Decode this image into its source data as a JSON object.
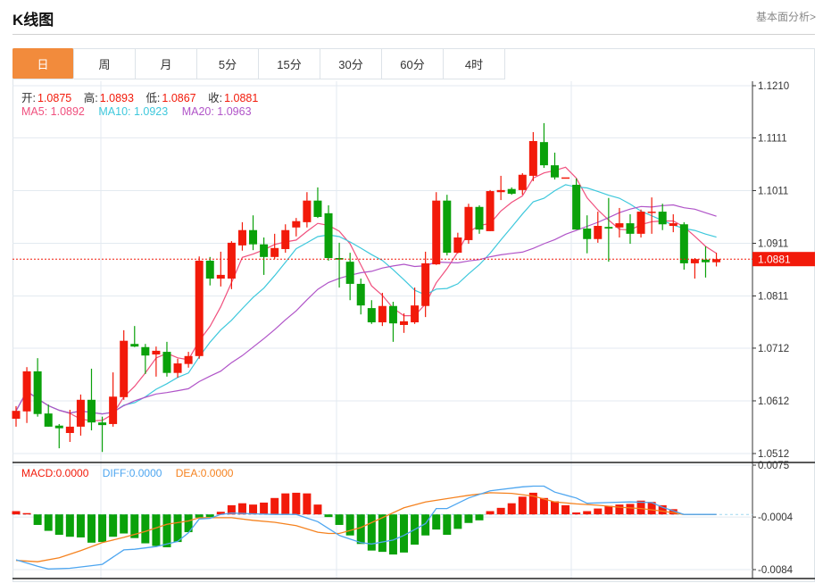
{
  "header": {
    "title": "K线图",
    "link": "基本面分析>"
  },
  "tabs": [
    {
      "label": "日",
      "active": true
    },
    {
      "label": "周"
    },
    {
      "label": "月"
    },
    {
      "label": "5分"
    },
    {
      "label": "15分"
    },
    {
      "label": "30分"
    },
    {
      "label": "60分"
    },
    {
      "label": "4时"
    }
  ],
  "ohlc_legend": {
    "open_label": "开:",
    "open": "1.0875",
    "high_label": "高:",
    "high": "1.0893",
    "low_label": "低:",
    "low": "1.0867",
    "close_label": "收:",
    "close": "1.0881"
  },
  "ma_legend": {
    "ma5": "MA5: 1.0892",
    "ma10": "MA10: 1.0923",
    "ma20": "MA20: 1.0963"
  },
  "macd_legend": {
    "macd": "MACD:0.0000",
    "diff": "DIFF:0.0000",
    "dea": "DEA:0.0000"
  },
  "colors": {
    "up": "#f21a0a",
    "down": "#0aa10a",
    "ma5": "#f0507e",
    "ma10": "#3ec8dc",
    "ma20": "#b054c8",
    "diff": "#4ea6f0",
    "dea": "#f5821f",
    "accent": "#f28b3c"
  },
  "chart_data": [
    {
      "type": "candlestick",
      "price_axis": {
        "ticks": [
          "1.1210",
          "1.1111",
          "1.1011",
          "1.0911",
          "1.0811",
          "1.0712",
          "1.0612",
          "1.0512"
        ],
        "range": [
          1.0512,
          1.121
        ]
      },
      "current_price": "1.0881",
      "ohlc": [
        [
          1.0578,
          1.0602,
          1.0563,
          1.0593
        ],
        [
          1.0592,
          1.0676,
          1.057,
          1.0668
        ],
        [
          1.0668,
          1.0693,
          1.0582,
          1.0587
        ],
        [
          1.0588,
          1.0605,
          1.0563,
          1.0563
        ],
        [
          1.0565,
          1.0568,
          1.0522,
          1.056
        ],
        [
          1.0551,
          1.0595,
          1.0534,
          1.0563
        ],
        [
          1.0563,
          1.0624,
          1.0546,
          1.0614
        ],
        [
          1.0614,
          1.0673,
          1.0556,
          1.0571
        ],
        [
          1.0571,
          1.0582,
          1.0515,
          1.0566
        ],
        [
          1.0568,
          1.0666,
          1.0563,
          1.062
        ],
        [
          1.0619,
          1.0746,
          1.0614,
          1.0726
        ],
        [
          1.072,
          1.0754,
          1.0714,
          1.0715
        ],
        [
          1.0714,
          1.072,
          1.0663,
          1.0698
        ],
        [
          1.07,
          1.0715,
          1.0658,
          1.0707
        ],
        [
          1.0705,
          1.0724,
          1.0658,
          1.0665
        ],
        [
          1.0665,
          1.0692,
          1.0656,
          1.0683
        ],
        [
          1.0682,
          1.0705,
          1.0675,
          1.0697
        ],
        [
          1.0697,
          1.0886,
          1.0692,
          1.0878
        ],
        [
          1.0878,
          1.0885,
          1.0831,
          1.0844
        ],
        [
          1.0844,
          1.0895,
          1.0829,
          1.0851
        ],
        [
          1.0844,
          1.0915,
          1.0824,
          1.0912
        ],
        [
          1.0907,
          1.0951,
          1.0897,
          1.0936
        ],
        [
          1.0936,
          1.0964,
          1.0898,
          1.0909
        ],
        [
          1.0909,
          1.0922,
          1.0851,
          1.0885
        ],
        [
          1.0885,
          1.0929,
          1.0881,
          1.0902
        ],
        [
          1.09,
          1.0947,
          1.0893,
          1.0936
        ],
        [
          1.0941,
          1.0959,
          1.0924,
          1.0953
        ],
        [
          1.0951,
          1.1008,
          1.0941,
          1.0992
        ],
        [
          1.0992,
          1.1017,
          1.0959,
          1.0961
        ],
        [
          1.0968,
          1.0983,
          1.0878,
          1.0883
        ],
        [
          1.0883,
          1.0912,
          1.0827,
          1.088
        ],
        [
          1.0876,
          1.0893,
          1.0803,
          1.0834
        ],
        [
          1.0834,
          1.0844,
          1.0776,
          1.0793
        ],
        [
          1.0788,
          1.0803,
          1.0758,
          1.0761
        ],
        [
          1.0761,
          1.0817,
          1.0754,
          1.0792
        ],
        [
          1.0792,
          1.08,
          1.0724,
          1.0759
        ],
        [
          1.0756,
          1.0778,
          1.0741,
          1.0763
        ],
        [
          1.0761,
          1.0827,
          1.0758,
          1.0793
        ],
        [
          1.0792,
          1.0895,
          1.0771,
          1.0873
        ],
        [
          1.0871,
          1.1008,
          1.087,
          1.0992
        ],
        [
          1.0992,
          1.1003,
          1.0888,
          1.0893
        ],
        [
          1.0893,
          1.0931,
          1.0892,
          1.0922
        ],
        [
          1.0917,
          1.0986,
          1.091,
          1.098
        ],
        [
          1.098,
          1.0983,
          1.0929,
          1.0937
        ],
        [
          1.0934,
          1.1012,
          1.0934,
          1.101
        ],
        [
          1.1008,
          1.1039,
          1.0993,
          1.1012
        ],
        [
          1.1014,
          1.1017,
          1.1003,
          1.1005
        ],
        [
          1.1012,
          1.1044,
          1.1003,
          1.1041
        ],
        [
          1.1039,
          1.1122,
          1.1029,
          1.1105
        ],
        [
          1.1103,
          1.1139,
          1.1054,
          1.1059
        ],
        [
          1.1059,
          1.1083,
          1.1032,
          1.1036
        ],
        [
          1.1036,
          1.1036,
          1.1036,
          1.1036
        ],
        [
          1.1022,
          1.1034,
          1.0937,
          1.0937
        ],
        [
          1.0939,
          1.0964,
          1.0892,
          1.0919
        ],
        [
          1.0919,
          1.0971,
          1.0912,
          1.0944
        ],
        [
          1.0942,
          1.0997,
          1.0876,
          1.0939
        ],
        [
          1.0941,
          1.0978,
          1.0922,
          1.0949
        ],
        [
          1.0949,
          1.0966,
          1.091,
          1.0929
        ],
        [
          1.0929,
          1.0975,
          1.0922,
          1.0971
        ],
        [
          1.0971,
          1.0998,
          1.0929,
          1.0971
        ],
        [
          1.0971,
          1.0986,
          1.0936,
          1.0947
        ],
        [
          1.0944,
          1.0966,
          1.0932,
          1.0949
        ],
        [
          1.0947,
          1.0951,
          1.0861,
          1.0873
        ],
        [
          1.0873,
          1.0883,
          1.0844,
          1.0881
        ],
        [
          1.088,
          1.0905,
          1.0846,
          1.0875
        ],
        [
          1.0875,
          1.0893,
          1.0867,
          1.0881
        ]
      ],
      "moving_averages": [
        5,
        10,
        20
      ]
    },
    {
      "type": "macd",
      "axis": {
        "ticks": [
          "0.0075",
          "-0.0004",
          "-0.0084"
        ],
        "range": [
          -0.0084,
          0.0075
        ]
      },
      "histogram": [
        0.0005,
        0.0002,
        -0.0016,
        -0.0025,
        -0.0031,
        -0.0034,
        -0.0035,
        -0.0043,
        -0.0042,
        -0.0034,
        -0.0029,
        -0.0036,
        -0.0044,
        -0.0048,
        -0.005,
        -0.0042,
        -0.0027,
        -0.0005,
        -0.0004,
        0.0004,
        0.0014,
        0.0017,
        0.0015,
        0.0018,
        0.0025,
        0.0032,
        0.0033,
        0.0032,
        0.0015,
        -0.0004,
        -0.0016,
        -0.0032,
        -0.0045,
        -0.0055,
        -0.0057,
        -0.0061,
        -0.0058,
        -0.0046,
        -0.0032,
        -0.0023,
        -0.0031,
        -0.0022,
        -0.0013,
        -0.0009,
        0.0005,
        0.001,
        0.0017,
        0.0027,
        0.0033,
        0.0025,
        0.002,
        0.0014,
        0.0003,
        0.0005,
        0.0009,
        0.0013,
        0.0015,
        0.0016,
        0.0021,
        0.0019,
        0.0014,
        0.0008,
        0,
        0,
        0,
        0
      ],
      "diff": [
        [
          0,
          -0.0069
        ],
        [
          2,
          -0.0079
        ],
        [
          3,
          -0.0083
        ],
        [
          5,
          -0.0082
        ],
        [
          7,
          -0.0078
        ],
        [
          8,
          -0.0076
        ],
        [
          10,
          -0.0054
        ],
        [
          11,
          -0.0053
        ],
        [
          13,
          -0.0049
        ],
        [
          15,
          -0.0041
        ],
        [
          16,
          -0.0028
        ],
        [
          17,
          -0.0007
        ],
        [
          18,
          -0.0006
        ],
        [
          19,
          0
        ],
        [
          20,
          0.0002
        ],
        [
          22,
          0.0001
        ],
        [
          24,
          0
        ],
        [
          26,
          0
        ],
        [
          28,
          -0.0011
        ],
        [
          30,
          -0.0032
        ],
        [
          32,
          -0.0043
        ],
        [
          33,
          -0.0045
        ],
        [
          35,
          -0.0039
        ],
        [
          36,
          -0.0032
        ],
        [
          38,
          -0.0014
        ],
        [
          39,
          0.0009
        ],
        [
          40,
          0.0009
        ],
        [
          42,
          0.0025
        ],
        [
          44,
          0.0036
        ],
        [
          47,
          0.0042
        ],
        [
          48,
          0.0043
        ],
        [
          49,
          0.0043
        ],
        [
          50,
          0.0034
        ],
        [
          52,
          0.0025
        ],
        [
          53,
          0.0017
        ],
        [
          55,
          0.0018
        ],
        [
          57,
          0.0019
        ],
        [
          59,
          0.0018
        ],
        [
          60,
          0.0011
        ],
        [
          62,
          0
        ],
        [
          65,
          0
        ]
      ],
      "dea": [
        [
          0,
          -0.007
        ],
        [
          2,
          -0.0072
        ],
        [
          4,
          -0.0066
        ],
        [
          6,
          -0.0055
        ],
        [
          8,
          -0.0043
        ],
        [
          10,
          -0.0035
        ],
        [
          12,
          -0.0026
        ],
        [
          14,
          -0.0015
        ],
        [
          16,
          -0.001
        ],
        [
          17,
          -0.0005
        ],
        [
          18,
          -0.0005
        ],
        [
          20,
          -0.0005
        ],
        [
          22,
          -0.0009
        ],
        [
          24,
          -0.0012
        ],
        [
          26,
          -0.0017
        ],
        [
          28,
          -0.0027
        ],
        [
          29,
          -0.0029
        ],
        [
          30,
          -0.0029
        ],
        [
          32,
          -0.002
        ],
        [
          34,
          -0.0005
        ],
        [
          36,
          0.001
        ],
        [
          38,
          0.0019
        ],
        [
          40,
          0.0024
        ],
        [
          42,
          0.0029
        ],
        [
          44,
          0.0033
        ],
        [
          46,
          0.0032
        ],
        [
          48,
          0.0028
        ],
        [
          50,
          0.0019
        ],
        [
          52,
          0.0016
        ],
        [
          54,
          0.0014
        ],
        [
          56,
          0.0011
        ],
        [
          58,
          0.0009
        ],
        [
          60,
          0.0005
        ],
        [
          62,
          0
        ],
        [
          65,
          0
        ]
      ]
    }
  ]
}
